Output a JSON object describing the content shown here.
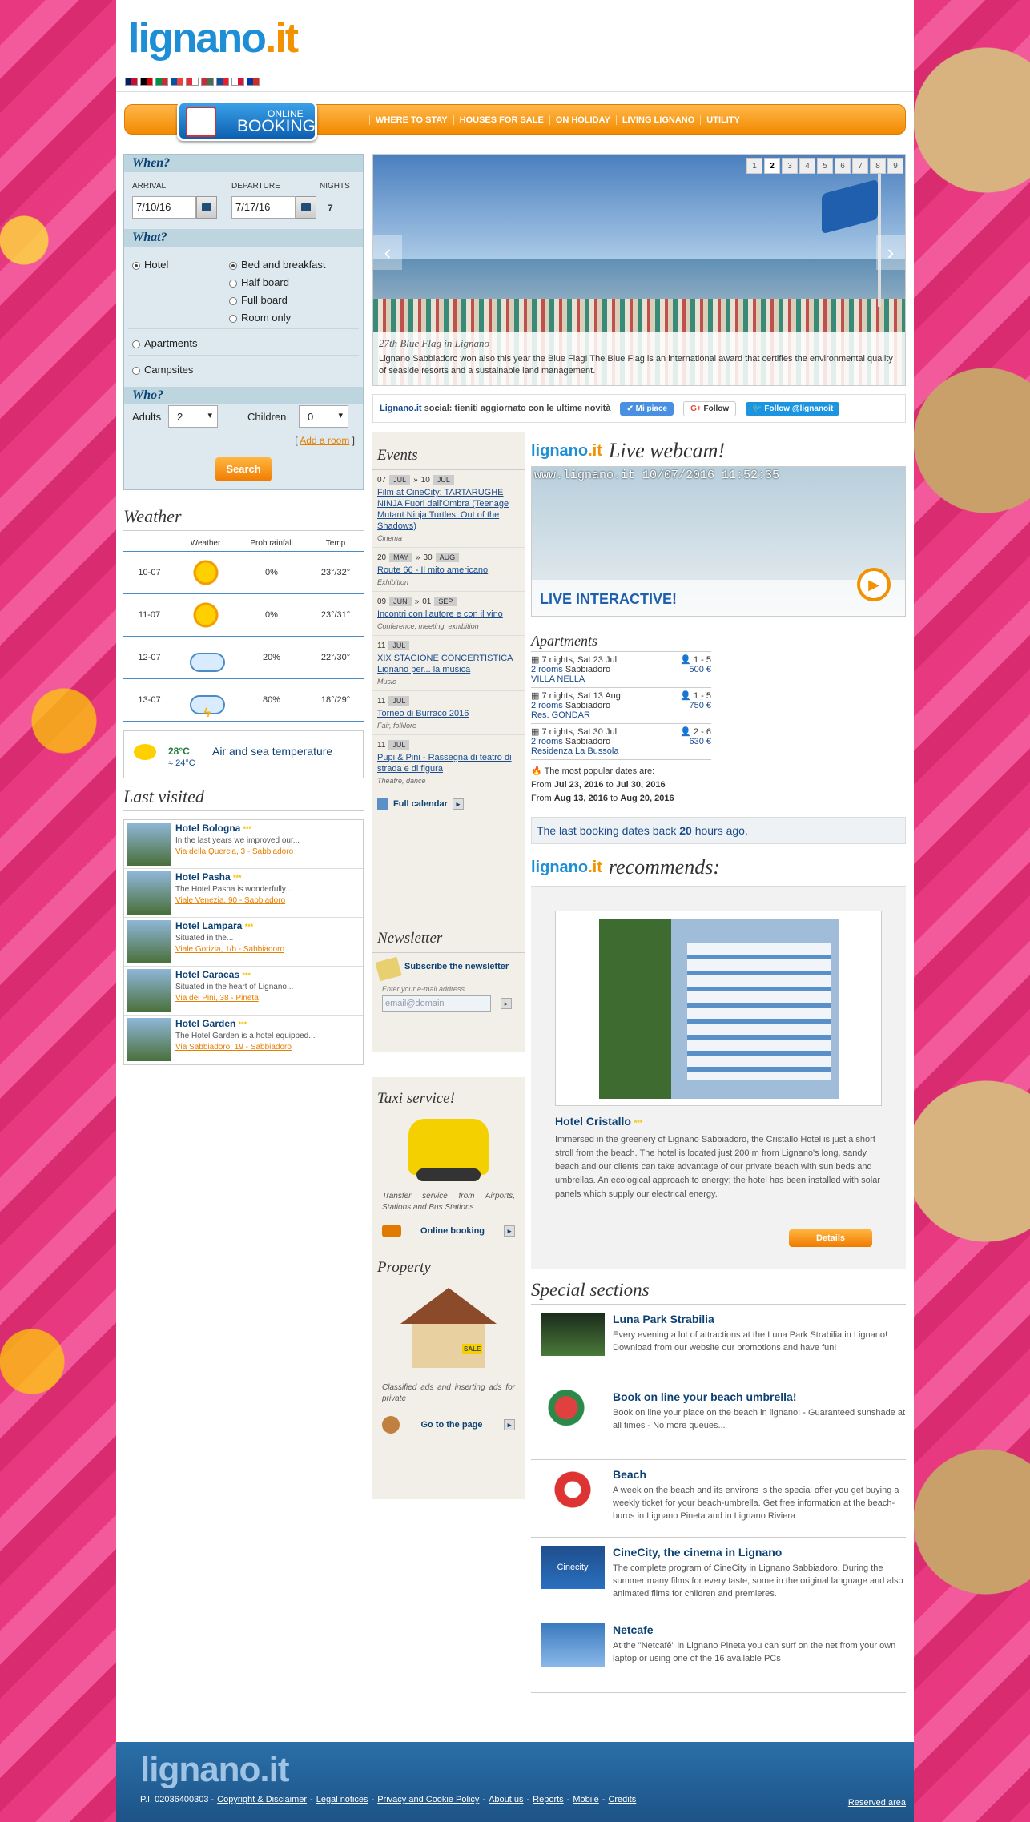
{
  "site": {
    "logo_main": "lignano",
    "logo_ext": ".it"
  },
  "flags": [
    {
      "icon": "uk-flag-icon",
      "colors": [
        "#012169",
        "#c8102e"
      ]
    },
    {
      "icon": "de-flag-icon",
      "colors": [
        "#000000",
        "#dd0000"
      ]
    },
    {
      "icon": "it-flag-icon",
      "colors": [
        "#009246",
        "#ce2b37"
      ]
    },
    {
      "icon": "fr-flag-icon",
      "colors": [
        "#0055a4",
        "#ef4135"
      ]
    },
    {
      "icon": "at-flag-icon",
      "colors": [
        "#ed2939",
        "#ffffff"
      ]
    },
    {
      "icon": "hu-flag-icon",
      "colors": [
        "#ce2939",
        "#477050"
      ]
    },
    {
      "icon": "sk-flag-icon",
      "colors": [
        "#0b4ea2",
        "#ee1c25"
      ]
    },
    {
      "icon": "pl-flag-icon",
      "colors": [
        "#ffffff",
        "#dc143c"
      ]
    },
    {
      "icon": "ru-flag-icon",
      "colors": [
        "#0039a6",
        "#d52b1e"
      ]
    }
  ],
  "nav": {
    "booking_line1": "ONLINE",
    "booking_line2": "BOOKING",
    "items": [
      "WHERE TO STAY",
      "HOUSES FOR SALE",
      "ON HOLIDAY",
      "LIVING LIGNANO",
      "UTILITY"
    ]
  },
  "search": {
    "when": "When?",
    "arrival_label": "ARRIVAL",
    "departure_label": "DEPARTURE",
    "nights_label": "NIGHTS",
    "arrival": "7/10/16",
    "departure": "7/17/16",
    "nights": "7",
    "what": "What?",
    "hotel": "Hotel",
    "bb": "Bed and breakfast",
    "half": "Half board",
    "full": "Full board",
    "room": "Room only",
    "apartments": "Apartments",
    "campsites": "Campsites",
    "who": "Who?",
    "adults_label": "Adults",
    "adults": "2",
    "children_label": "Children",
    "children": "0",
    "add_room": "Add a room",
    "button": "Search"
  },
  "weather": {
    "title": "Weather",
    "h_weather": "Weather",
    "h_rain": "Prob rainfall",
    "h_temp": "Temp",
    "rows": [
      {
        "date": "10-07",
        "icon": "sun-icon",
        "rain": "0%",
        "temp": "23°/32°"
      },
      {
        "date": "11-07",
        "icon": "sun-icon",
        "rain": "0%",
        "temp": "23°/31°"
      },
      {
        "date": "12-07",
        "icon": "partly-cloudy-icon",
        "rain": "20%",
        "temp": "22°/30°"
      },
      {
        "date": "13-07",
        "icon": "storm-icon",
        "rain": "80%",
        "temp": "18°/29°"
      }
    ],
    "air": "28°C",
    "sea": "24°C",
    "air_sea_label": "Air and sea temperature"
  },
  "last_visited": {
    "title": "Last visited",
    "items": [
      {
        "name": "Hotel Bologna",
        "stars": "***",
        "desc": "In the last years we improved our...",
        "addr": "Via della Quercia, 3 - Sabbiadoro"
      },
      {
        "name": "Hotel Pasha",
        "stars": "***",
        "desc": "The Hotel Pasha is wonderfully...",
        "addr": "Viale Venezia, 90 - Sabbiadoro"
      },
      {
        "name": "Hotel Lampara",
        "stars": "***",
        "desc": "Situated in the...",
        "addr": "Viale Gorizia, 1/b - Sabbiadoro"
      },
      {
        "name": "Hotel Caracas",
        "stars": "***",
        "desc": "Situated in the heart of Lignano...",
        "addr": "Via dei Pini, 38 - Pineta"
      },
      {
        "name": "Hotel Garden",
        "stars": "***",
        "desc": "The Hotel Garden is a hotel equipped...",
        "addr": "Via Sabbiadoro, 19 - Sabbiadoro"
      }
    ]
  },
  "slider": {
    "pages": [
      "1",
      "2",
      "3",
      "4",
      "5",
      "6",
      "7",
      "8",
      "9"
    ],
    "active_page": "2",
    "caption_title": "27th Blue Flag in Lignano",
    "caption_text": "Lignano Sabbiadoro won also this year the Blue Flag! The Blue Flag is an international award that certifies the environmental quality of seaside resorts and a sustainable land management."
  },
  "social": {
    "brand": "Lignano.it",
    "text": " social: tieniti aggiornato con le ultime novità",
    "fb": "Mi piace",
    "gplus": "Follow",
    "twitter": "Follow @lignanoit"
  },
  "events": {
    "title": "Events",
    "items": [
      {
        "d1": "07",
        "m1": "JUL",
        "d2": "10",
        "m2": "JUL",
        "title": "Film at CineCity: TARTARUGHE NINJA Fuori dall'Ombra (Teenage Mutant Ninja Turtles: Out of the Shadows)",
        "cat": "Cinema"
      },
      {
        "d1": "20",
        "m1": "MAY",
        "d2": "30",
        "m2": "AUG",
        "title": "Route 66 - Il mito americano",
        "cat": "Exhibition"
      },
      {
        "d1": "09",
        "m1": "JUN",
        "d2": "01",
        "m2": "SEP",
        "title": "Incontri con l'autore e con il vino",
        "cat": "Conference, meeting, exhibition"
      },
      {
        "d1": "11",
        "m1": "JUL",
        "d2": "",
        "m2": "",
        "title": "XIX STAGIONE CONCERTISTICA Lignano per... la musica",
        "cat": "Music"
      },
      {
        "d1": "11",
        "m1": "JUL",
        "d2": "",
        "m2": "",
        "title": "Torneo di Burraco 2016",
        "cat": "Fair, folklore"
      },
      {
        "d1": "11",
        "m1": "JUL",
        "d2": "",
        "m2": "",
        "title": "Pupi & Pini - Rassegna di teatro di strada e di figura",
        "cat": "Theatre, dance"
      }
    ],
    "full_calendar": "Full calendar"
  },
  "newsletter": {
    "title": "Newsletter",
    "subscribe": "Subscribe the newsletter",
    "enter": "Enter your e-mail address",
    "placeholder": "email@domain"
  },
  "taxi": {
    "title": "Taxi service!",
    "text": "Transfer service from Airports, Stations and Bus Stations",
    "link": "Online booking"
  },
  "property": {
    "title": "Property",
    "sale_sign": "SALE",
    "text": "Classified ads and inserting ads for private",
    "link": "Go to the page"
  },
  "webcam": {
    "title": "Live webcam!",
    "stamp": "www.lignano.it 10/07/2016 11:52:35",
    "live": "LIVE INTERACTIVE!"
  },
  "apartments": {
    "title": "Apartments",
    "items": [
      {
        "nights": "7 nights, Sat 23 Jul",
        "people": "1 - 5",
        "rooms": "2 rooms",
        "zone": "Sabbiadoro",
        "price": "500 €",
        "name": "VILLA NELLA"
      },
      {
        "nights": "7 nights, Sat 13 Aug",
        "people": "1 - 5",
        "rooms": "2 rooms",
        "zone": "Sabbiadoro",
        "price": "750 €",
        "name": "Res. GONDAR"
      },
      {
        "nights": "7 nights, Sat 30 Jul",
        "people": "2 - 6",
        "rooms": "2 rooms",
        "zone": "Sabbiadoro",
        "price": "630 €",
        "name": "Residenza La Bussola"
      }
    ],
    "popular_label": "The most popular dates are:",
    "pop1_from": "Jul 23, 2016",
    "pop1_to": "Jul 30, 2016",
    "pop2_from": "Aug 13, 2016",
    "pop2_to": "Aug 20, 2016",
    "from": "From",
    "to": "to"
  },
  "last_booking": {
    "pre": "The last booking dates back ",
    "hours": "20",
    "post": " hours ago."
  },
  "recommends": {
    "title": "recommends:",
    "name": "Hotel Cristallo",
    "stars": "***",
    "desc": "Immersed in the greenery of Lignano Sabbiadoro, the Cristallo Hotel is just a short stroll from the beach. The hotel is located just 200 m from Lignano's long, sandy beach and our clients can take advantage of our private beach with sun beds and umbrellas. An ecological approach to energy; the hotel has been installed with solar panels which supply our electrical energy.",
    "button": "Details"
  },
  "special": {
    "title": "Special sections",
    "items": [
      {
        "title": "Luna Park Strabilia",
        "desc": "Every evening a lot of attractions at the Luna Park Strabilia in Lignano! Download from our website our promotions and have fun!",
        "icon": "luna-park-image"
      },
      {
        "title": "Book on line your beach umbrella!",
        "desc": "Book on line your place on the beach in lignano! - Guaranteed sunshade at all times - No more queues...",
        "icon": "umbrella-icon"
      },
      {
        "title": "Beach",
        "desc": "A week on the beach and its environs is the special offer you get buying a weekly ticket for your beach-umbrella. Get free information at the beach-buros in Lignano Pineta and in Lignano Riviera",
        "icon": "lifebuoy-icon"
      },
      {
        "title": "CineCity, the cinema in Lignano",
        "desc": "The complete program of CineCity in Lignano Sabbiadoro. During the summer many films for every taste, some in the original language and also animated films for children and premieres.",
        "icon": "cinecity-logo",
        "logo_text": "Cinecity"
      },
      {
        "title": "Netcafe",
        "desc": "At the \"Netcafè\" in Lignano Pineta you can surf on the net from your own laptop or using one of the 16 available PCs",
        "icon": "computer-icon"
      }
    ]
  },
  "footer": {
    "logo": "lignano.it",
    "piva": "P.I. 02036400303 - ",
    "links": [
      "Copyright & Disclaimer",
      "Legal notices",
      "Privacy and Cookie Policy",
      "About us",
      "Reports",
      "Mobile",
      "Credits"
    ],
    "reserved": "Reserved area"
  }
}
